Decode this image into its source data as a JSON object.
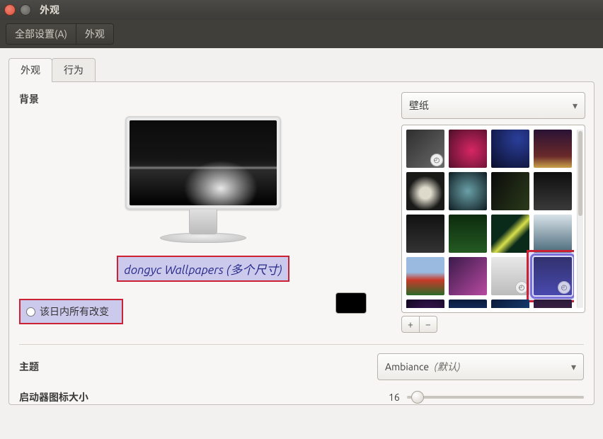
{
  "window": {
    "title": "外观"
  },
  "toolbar": {
    "all_settings": "全部设置(A)",
    "crumb": "外观"
  },
  "tabs": {
    "look": "外观",
    "behavior": "行为"
  },
  "background": {
    "label": "背景",
    "source_combo": "壁纸",
    "wallpaper_name": "dongyc Wallpapers (多个尺寸)",
    "day_changes": "该日内所有改变",
    "add": "+",
    "remove": "−",
    "color_swatch": "#000000",
    "thumbs": [
      {
        "class": "t0",
        "badge": true
      },
      {
        "class": "t1"
      },
      {
        "class": "t2"
      },
      {
        "class": "t3"
      },
      {
        "class": "t4"
      },
      {
        "class": "t5"
      },
      {
        "class": "t6"
      },
      {
        "class": "t7"
      },
      {
        "class": "t8"
      },
      {
        "class": "t9"
      },
      {
        "class": "t10"
      },
      {
        "class": "t11"
      },
      {
        "class": "t12"
      },
      {
        "class": "t13"
      },
      {
        "class": "t14",
        "badge": true
      },
      {
        "class": "t15",
        "badge": true,
        "selected": true
      },
      {
        "class": "t16"
      },
      {
        "class": "t17"
      },
      {
        "class": "t18"
      },
      {
        "class": "t19"
      }
    ]
  },
  "theme": {
    "label": "主题",
    "value": "Ambiance",
    "default_suffix": "(默认)"
  },
  "launcher": {
    "label": "启动器图标大小",
    "value": "16"
  }
}
